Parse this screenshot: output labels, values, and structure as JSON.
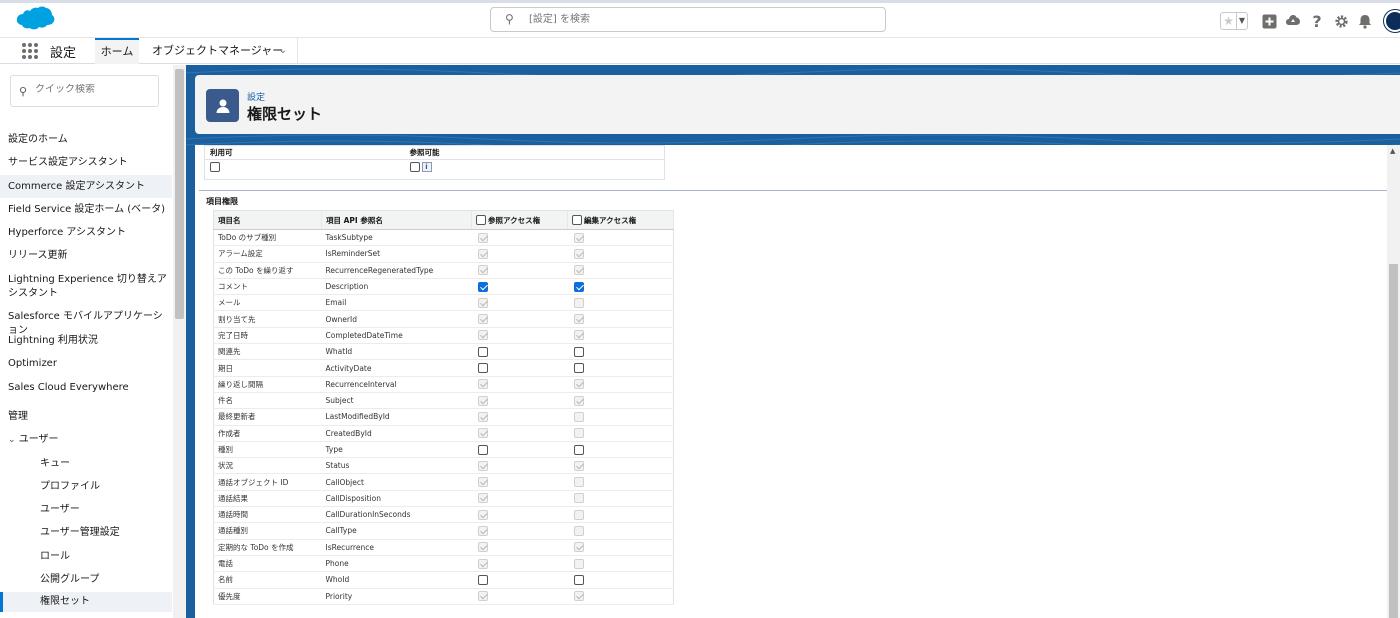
{
  "top": {
    "search_placeholder": "[設定] を検索"
  },
  "nav": {
    "app_name": "設定",
    "tabs": [
      {
        "label": "ホーム"
      },
      {
        "label": "オブジェクトマネージャー"
      }
    ]
  },
  "sidebar": {
    "quick_search_placeholder": "クイック検索",
    "items": [
      {
        "label": "設定のホーム"
      },
      {
        "label": "サービス設定アシスタント"
      },
      {
        "label": "Commerce 設定アシスタント"
      },
      {
        "label": "Field Service 設定ホーム (ベータ)"
      },
      {
        "label": "Hyperforce アシスタント"
      },
      {
        "label": "リリース更新"
      },
      {
        "label": "Lightning Experience 切り替えアシスタント"
      },
      {
        "label": "Salesforce モバイルアプリケーション"
      },
      {
        "label": "Lightning 利用状況"
      },
      {
        "label": "Optimizer"
      },
      {
        "label": "Sales Cloud Everywhere"
      }
    ],
    "section_label": "管理",
    "group_label": "ユーザー",
    "sub_items": [
      {
        "label": "キュー"
      },
      {
        "label": "プロファイル"
      },
      {
        "label": "ユーザー"
      },
      {
        "label": "ユーザー管理設定"
      },
      {
        "label": "ロール"
      },
      {
        "label": "公開グループ"
      },
      {
        "label": "権限セット"
      }
    ]
  },
  "header": {
    "breadcrumb": "設定",
    "title": "権限セット"
  },
  "availability": {
    "col_available": "利用可",
    "col_visible": "参照可能"
  },
  "field_permissions": {
    "section_label": "項目権限",
    "col_field_name": "項目名",
    "col_api_name": "項目 API 参照名",
    "col_read": "参照アクセス権",
    "col_edit": "編集アクセス権",
    "rows": [
      {
        "name": "ToDo のサブ種別",
        "api": "TaskSubtype",
        "read": "locked-on",
        "edit": "locked-on"
      },
      {
        "name": "アラーム設定",
        "api": "IsReminderSet",
        "read": "locked-on",
        "edit": "locked-on"
      },
      {
        "name": "この ToDo を繰り返す",
        "api": "RecurrenceRegeneratedType",
        "read": "locked-on",
        "edit": "locked-on"
      },
      {
        "name": "コメント",
        "api": "Description",
        "read": "checked",
        "edit": "checked"
      },
      {
        "name": "メール",
        "api": "Email",
        "read": "locked-on",
        "edit": "locked-off"
      },
      {
        "name": "割り当て先",
        "api": "OwnerId",
        "read": "locked-on",
        "edit": "locked-on"
      },
      {
        "name": "完了日時",
        "api": "CompletedDateTime",
        "read": "locked-on",
        "edit": "locked-on"
      },
      {
        "name": "関連先",
        "api": "WhatId",
        "read": "unchecked",
        "edit": "unchecked"
      },
      {
        "name": "期日",
        "api": "ActivityDate",
        "read": "unchecked",
        "edit": "unchecked"
      },
      {
        "name": "繰り返し間隔",
        "api": "RecurrenceInterval",
        "read": "locked-on",
        "edit": "locked-on"
      },
      {
        "name": "件名",
        "api": "Subject",
        "read": "locked-on",
        "edit": "locked-on"
      },
      {
        "name": "最終更新者",
        "api": "LastModifiedById",
        "read": "locked-on",
        "edit": "locked-off"
      },
      {
        "name": "作成者",
        "api": "CreatedById",
        "read": "locked-on",
        "edit": "locked-off"
      },
      {
        "name": "種別",
        "api": "Type",
        "read": "unchecked",
        "edit": "unchecked"
      },
      {
        "name": "状況",
        "api": "Status",
        "read": "locked-on",
        "edit": "locked-on"
      },
      {
        "name": "通話オブジェクト ID",
        "api": "CallObject",
        "read": "locked-on",
        "edit": "locked-off"
      },
      {
        "name": "通話結果",
        "api": "CallDisposition",
        "read": "locked-on",
        "edit": "locked-off"
      },
      {
        "name": "通話時間",
        "api": "CallDurationInSeconds",
        "read": "locked-on",
        "edit": "locked-off"
      },
      {
        "name": "通話種別",
        "api": "CallType",
        "read": "locked-on",
        "edit": "locked-off"
      },
      {
        "name": "定期的な ToDo を作成",
        "api": "IsRecurrence",
        "read": "locked-on",
        "edit": "locked-on"
      },
      {
        "name": "電話",
        "api": "Phone",
        "read": "locked-on",
        "edit": "locked-off"
      },
      {
        "name": "名前",
        "api": "WhoId",
        "read": "unchecked",
        "edit": "unchecked"
      },
      {
        "name": "優先度",
        "api": "Priority",
        "read": "locked-on",
        "edit": "locked-on"
      }
    ]
  },
  "colors": {
    "brand_blue": "#0176d3",
    "header_band": "#1b5f9e",
    "icon_bg": "#3a5a8c"
  }
}
